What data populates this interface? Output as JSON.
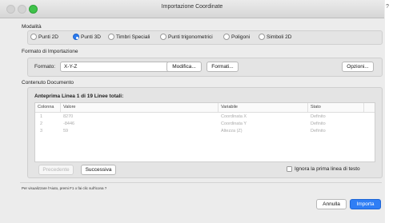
{
  "window": {
    "title": "Importazione Coordinate",
    "help_glyph": "?"
  },
  "modalita": {
    "label": "Modalità",
    "options": [
      {
        "label": "Punti 2D",
        "selected": false
      },
      {
        "label": "Punti 3D",
        "selected": true
      },
      {
        "label": "Timbri Speciali",
        "selected": false
      },
      {
        "label": "Punti trigonometrici",
        "selected": false
      },
      {
        "label": "Poligoni",
        "selected": false
      },
      {
        "label": "Simboli 2D",
        "selected": false
      }
    ]
  },
  "formato_section": {
    "label": "Formato di Importazione",
    "format_label": "Formato:",
    "format_value": "X-Y-Z",
    "modifica_button": "Modifica...",
    "formati_button": "Formati...",
    "opzioni_button": "Opzioni..."
  },
  "contenuto": {
    "label": "Contenuto Documento",
    "preview_label": "Anteprima Linea 1 di 19 Linee totali:",
    "columns": [
      "Colonna",
      "Valore",
      "Variabile",
      "Stato"
    ],
    "rows": [
      {
        "colonna": "1",
        "valore": "8270",
        "variabile": "Coordinata X",
        "stato": "Definito"
      },
      {
        "colonna": "2",
        "valore": "-8446",
        "variabile": "Coordinata Y",
        "stato": "Definito"
      },
      {
        "colonna": "3",
        "valore": "59",
        "variabile": "Altezza (Z)",
        "stato": "Definito"
      }
    ],
    "precedente_button": "Precedente",
    "successiva_button": "Successiva",
    "ignore_first_line_label": "Ignora la prima linea di testo",
    "ignore_first_line_checked": false
  },
  "footer": {
    "hint": "Per visualizzare l'Aiuto, premi F1 o fai clic sull'icona ?",
    "annulla_button": "Annulla",
    "importa_button": "Importa"
  },
  "colors": {
    "accent": "#2f7ef5",
    "zoom_button": "#3fc24a"
  }
}
